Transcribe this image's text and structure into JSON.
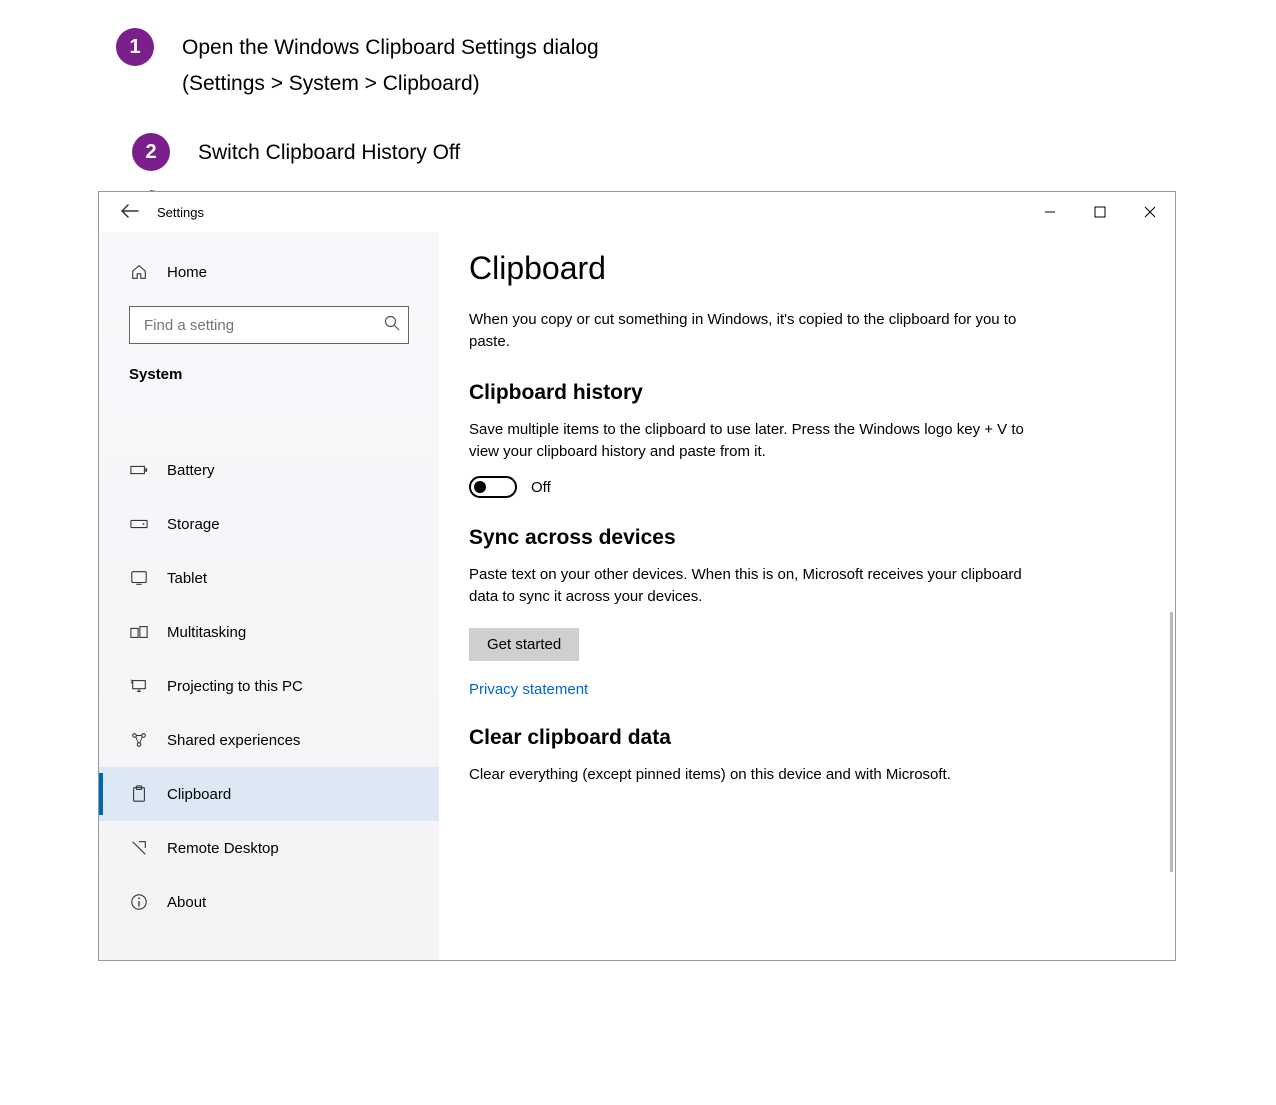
{
  "instructions": {
    "step1": {
      "num": "1",
      "line1": "Open the Windows Clipboard Settings dialog",
      "line2": "(Settings > System > Clipboard)"
    },
    "step2": {
      "num": "2",
      "text": "Switch Clipboard History Off"
    }
  },
  "window": {
    "title": "Settings",
    "controls": {
      "min": "—",
      "max": "☐",
      "close": "✕"
    }
  },
  "sidebar": {
    "home_label": "Home",
    "search_placeholder": "Find a setting",
    "category": "System",
    "items": [
      {
        "icon": "battery",
        "label": "Battery"
      },
      {
        "icon": "storage",
        "label": "Storage"
      },
      {
        "icon": "tablet",
        "label": "Tablet"
      },
      {
        "icon": "multitask",
        "label": "Multitasking"
      },
      {
        "icon": "project",
        "label": "Projecting to this PC"
      },
      {
        "icon": "shared",
        "label": "Shared experiences"
      },
      {
        "icon": "clipboard",
        "label": "Clipboard",
        "selected": true
      },
      {
        "icon": "remote",
        "label": "Remote Desktop"
      },
      {
        "icon": "about",
        "label": "About"
      }
    ]
  },
  "content": {
    "heading": "Clipboard",
    "intro": "When you copy or cut something in Windows, it's copied to the clipboard for you to paste.",
    "history_heading": "Clipboard history",
    "history_desc": "Save multiple items to the clipboard to use later. Press the Windows logo key + V to view your clipboard history and paste from it.",
    "history_toggle_label": "Off",
    "sync_heading": "Sync across devices",
    "sync_desc": "Paste text on your other devices. When this is on, Microsoft receives your clipboard data to sync it across your devices.",
    "sync_button": "Get started",
    "privacy_link": "Privacy statement",
    "clear_heading": "Clear clipboard data",
    "clear_desc": "Clear everything (except pinned items) on this device and with Microsoft."
  }
}
